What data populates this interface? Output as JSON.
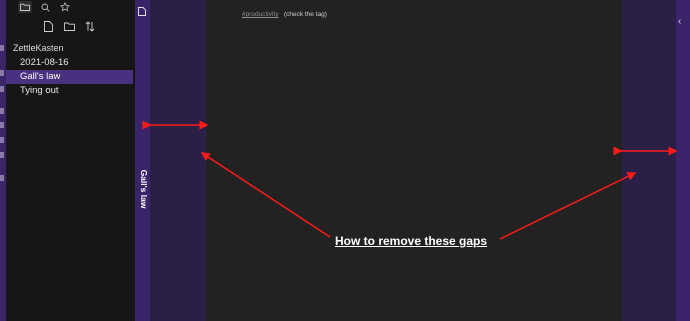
{
  "sidebar": {
    "tabs": [
      {
        "icon": "folder-icon"
      },
      {
        "icon": "search-icon"
      },
      {
        "icon": "star-icon"
      }
    ],
    "actions": [
      {
        "icon": "new-note-icon"
      },
      {
        "icon": "new-folder-icon"
      },
      {
        "icon": "sort-icon"
      }
    ],
    "vault_name": "ZettleKasten",
    "items": [
      {
        "label": "2021-08-16",
        "selected": false
      },
      {
        "label": "Gall's law",
        "selected": true
      },
      {
        "label": "Tying out",
        "selected": false
      }
    ]
  },
  "left_pane": {
    "icon": "file-icon",
    "title": "Gall's law"
  },
  "editor": {
    "tag": "#productivity",
    "tag_note": "(check the tag)"
  },
  "right_pane": {
    "icon": "chevron-left-icon",
    "glyph": "‹"
  },
  "annotation": {
    "label": "How to remove these gaps",
    "color": "#ff1a1a"
  },
  "colors": {
    "accent": "#4a3080",
    "strip": "#3a2368",
    "gap": "#2b1f47",
    "editor_bg": "#222222"
  }
}
